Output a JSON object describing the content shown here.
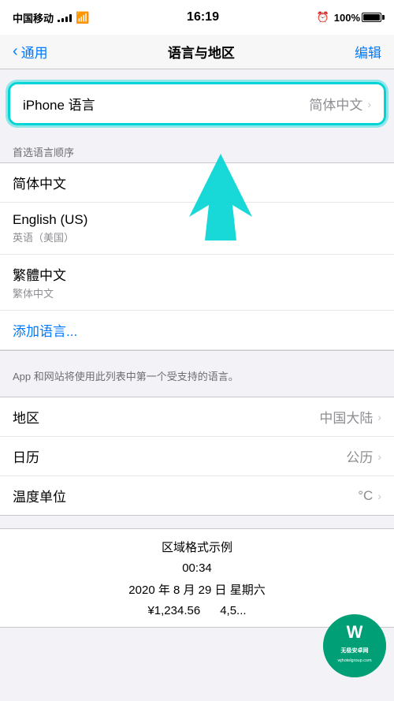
{
  "statusBar": {
    "carrier": "中国移动",
    "time": "16:19",
    "battery": "100%",
    "charging": true
  },
  "navBar": {
    "back_label": "通用",
    "title": "语言与地区",
    "action_label": "编辑"
  },
  "iphone_language_section": {
    "label": "iPhone 语言",
    "value": "简体中文"
  },
  "preferred_section_header": "首选语言顺序",
  "preferred_languages": [
    {
      "main": "简体中文",
      "sub": ""
    },
    {
      "main": "English (US)",
      "sub": "英语（美国）"
    },
    {
      "main": "繁體中文",
      "sub": "繁体中文"
    }
  ],
  "add_language_label": "添加语言...",
  "info_text": "App 和网站将使用此列表中第一个受支持的语言。",
  "region_items": [
    {
      "label": "地区",
      "value": "中国大陆"
    },
    {
      "label": "日历",
      "value": "公历"
    },
    {
      "label": "温度单位",
      "value": "°C"
    }
  ],
  "format_example": {
    "header": "区域格式示例",
    "time": "00:34",
    "date": "2020 年 8 月 29 日 星期六",
    "currency": "¥1,234.56",
    "number": "4,5..."
  },
  "watermark": {
    "text": "无极安卓网",
    "url": "wjhotelgroup.com"
  }
}
